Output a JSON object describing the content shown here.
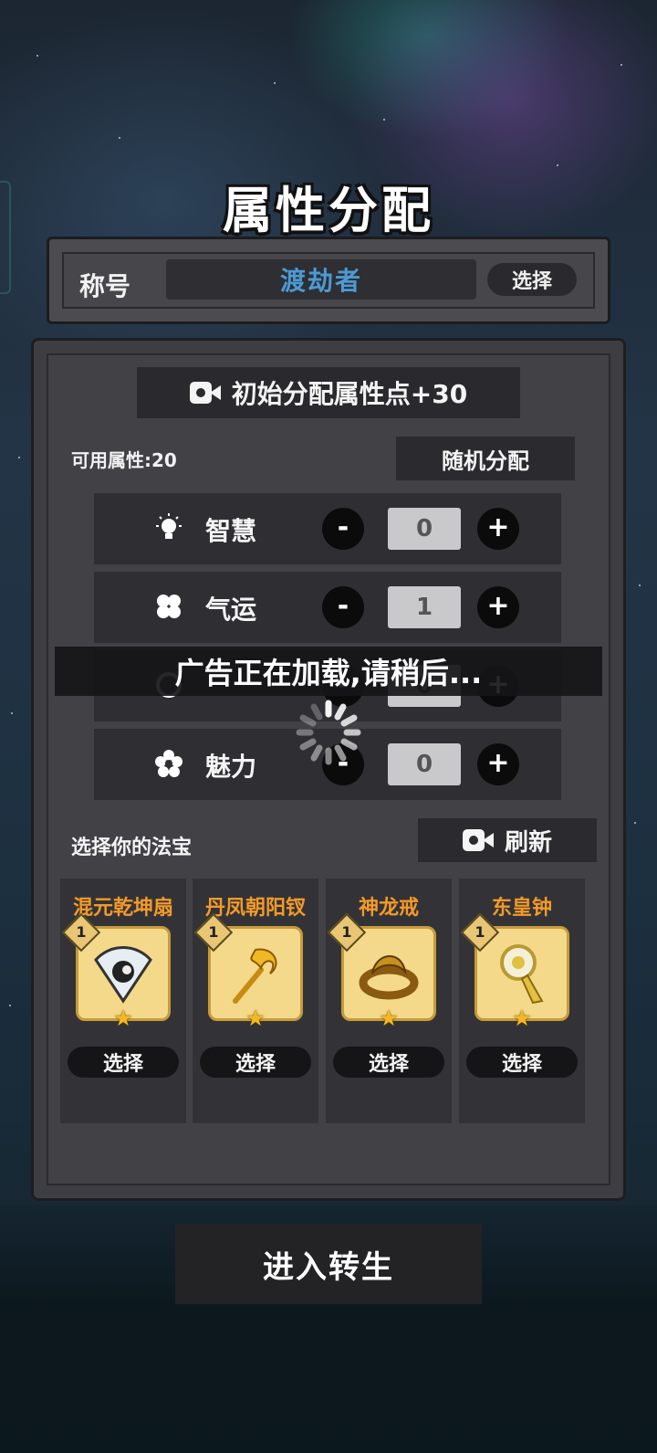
{
  "page_title": "属性分配",
  "title_panel": {
    "label": "称号",
    "value": "渡劫者",
    "select_label": "选择"
  },
  "ad_bonus": {
    "icon": "video-camera-icon",
    "label": "初始分配属性点+30"
  },
  "available_points": "可用属性:20",
  "random_button": "随机分配",
  "attributes": [
    {
      "icon": "lightbulb-icon",
      "label": "智慧",
      "value": "0",
      "minus": "-",
      "plus": "+"
    },
    {
      "icon": "clover-icon",
      "label": "气运",
      "value": "1",
      "minus": "-",
      "plus": "+"
    },
    {
      "icon": "cycle-icon",
      "label": "",
      "value": "0",
      "minus": "-",
      "plus": "+"
    },
    {
      "icon": "flower-icon",
      "label": "魅力",
      "value": "0",
      "minus": "-",
      "plus": "+"
    }
  ],
  "toast": "广告正在加载,请稍后...",
  "treasure": {
    "title": "选择你的法宝",
    "refresh_label": "刷新",
    "items": [
      {
        "name": "混元乾坤扇",
        "level": "1",
        "icon": "fan-icon",
        "select": "选择"
      },
      {
        "name": "丹凤朝阳钗",
        "level": "1",
        "icon": "hairpin-icon",
        "select": "选择"
      },
      {
        "name": "神龙戒",
        "level": "1",
        "icon": "dragon-ring-icon",
        "select": "选择"
      },
      {
        "name": "东皇钟",
        "level": "1",
        "icon": "bell-icon",
        "select": "选择"
      }
    ]
  },
  "enter_button": "进入转生",
  "colors": {
    "title_value": "#4c9ad4",
    "item_name": "#f49a28",
    "panel": "#3d3d42"
  }
}
